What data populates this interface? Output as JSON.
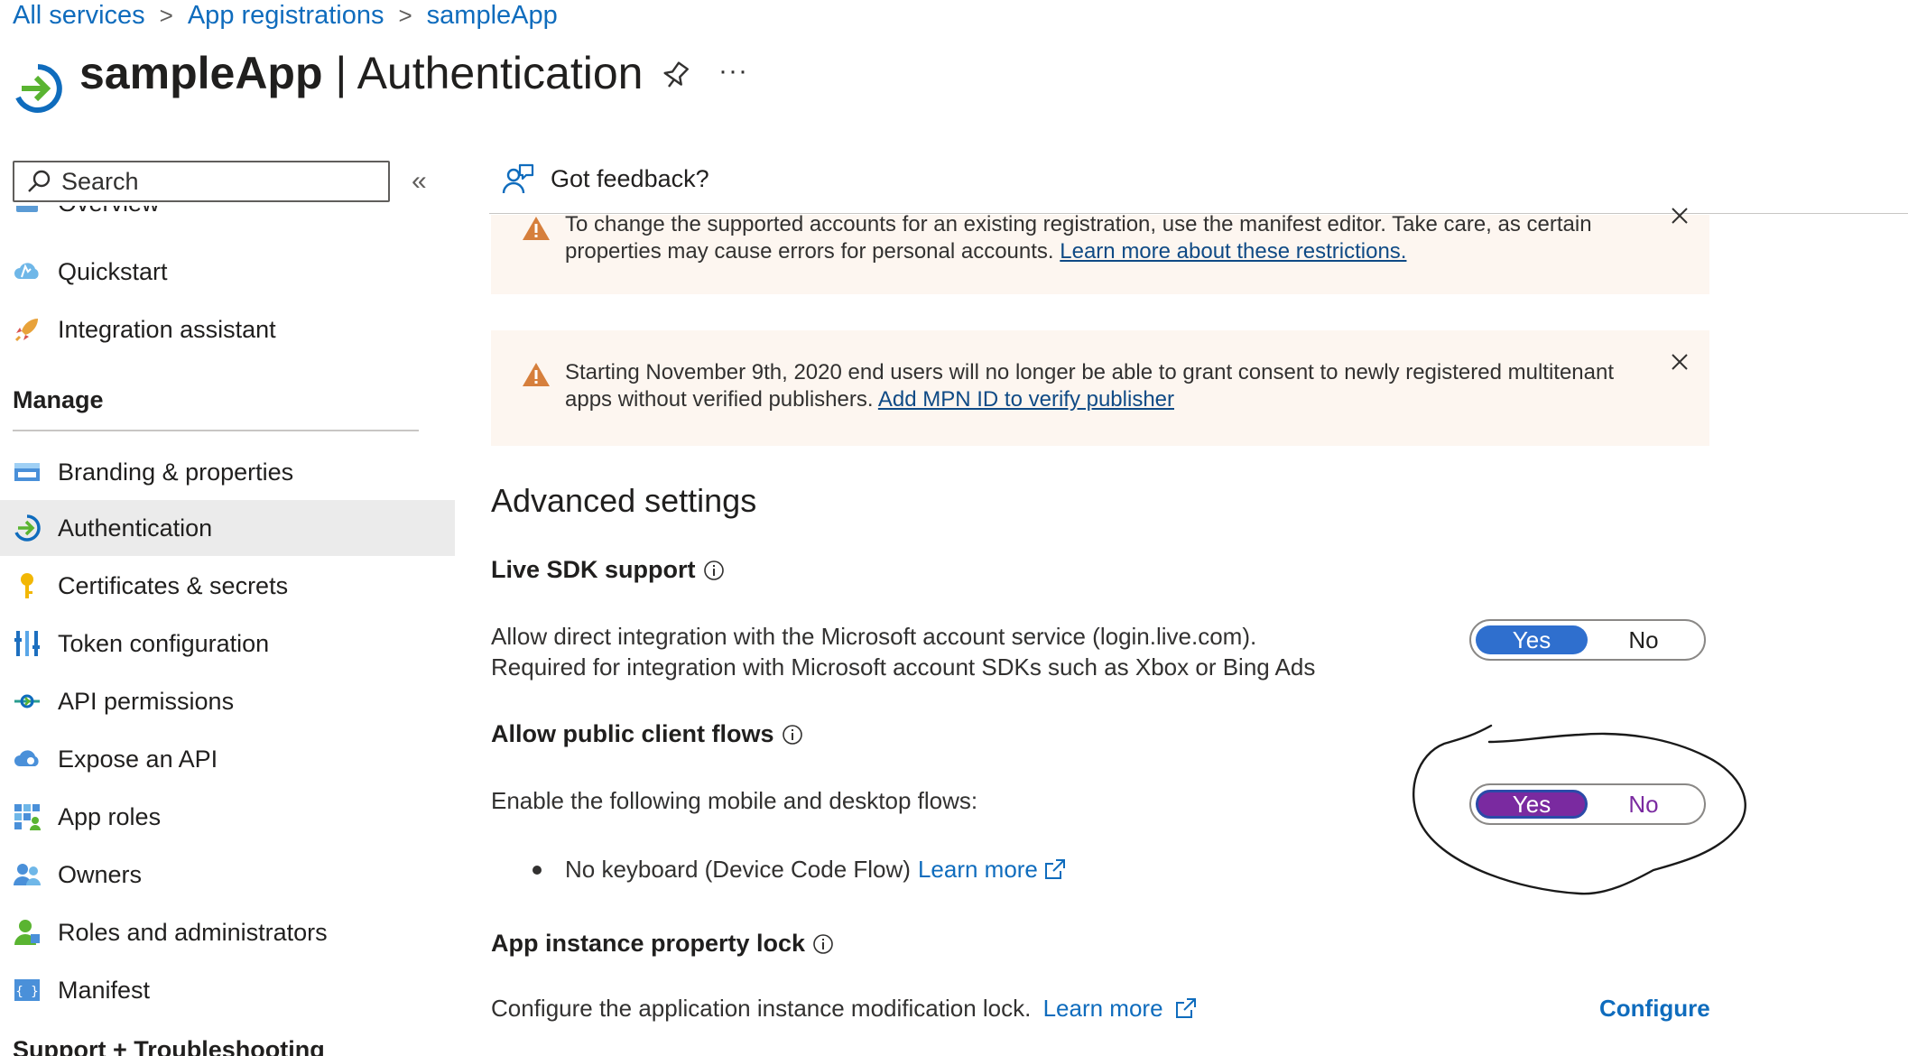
{
  "breadcrumb": [
    "All services",
    "App registrations",
    "sampleApp"
  ],
  "header": {
    "app_name": "sampleApp",
    "divider": "|",
    "page": "Authentication",
    "more": "···"
  },
  "sidebar": {
    "search_placeholder": "Search",
    "collapse_glyph": "«",
    "top_items": [
      {
        "label": "Overview",
        "icon": "overview-icon"
      },
      {
        "label": "Quickstart",
        "icon": "quickstart-cloud-icon"
      },
      {
        "label": "Integration assistant",
        "icon": "rocket-icon"
      }
    ],
    "manage_heading": "Manage",
    "manage_items": [
      {
        "label": "Branding & properties",
        "icon": "branding-icon"
      },
      {
        "label": "Authentication",
        "icon": "authentication-icon",
        "active": true
      },
      {
        "label": "Certificates & secrets",
        "icon": "key-icon"
      },
      {
        "label": "Token configuration",
        "icon": "token-bars-icon"
      },
      {
        "label": "API permissions",
        "icon": "api-permissions-icon"
      },
      {
        "label": "Expose an API",
        "icon": "cloud-api-icon"
      },
      {
        "label": "App roles",
        "icon": "app-roles-icon"
      },
      {
        "label": "Owners",
        "icon": "owners-icon"
      },
      {
        "label": "Roles and administrators",
        "icon": "roles-admin-icon"
      },
      {
        "label": "Manifest",
        "icon": "manifest-icon"
      }
    ],
    "support_heading": "Support + Troubleshooting"
  },
  "command_bar": {
    "feedback_label": "Got feedback?"
  },
  "banners": [
    {
      "text": "To change the supported accounts for an existing registration, use the manifest editor. Take care, as certain properties may cause errors for personal accounts.",
      "link": "Learn more about these restrictions."
    },
    {
      "text": "Starting November 9th, 2020 end users will no longer be able to grant consent to newly registered multitenant apps without verified publishers.",
      "link": "Add MPN ID to verify publisher"
    }
  ],
  "advanced": {
    "title": "Advanced settings",
    "live_sdk": {
      "title": "Live SDK support",
      "line1": "Allow direct integration with the Microsoft account service (login.live.com).",
      "line2": "Required for integration with Microsoft account SDKs such as Xbox or Bing Ads",
      "toggle": {
        "yes": "Yes",
        "no": "No",
        "selected": "Yes"
      }
    },
    "public_client": {
      "title": "Allow public client flows",
      "desc": "Enable the following mobile and desktop flows:",
      "bullet": "No keyboard (Device Code Flow)",
      "learn_more": "Learn more",
      "toggle": {
        "yes": "Yes",
        "no": "No",
        "selected": "Yes"
      }
    },
    "lock": {
      "title": "App instance property lock",
      "desc": "Configure the application instance modification lock.",
      "learn_more": "Learn more",
      "configure": "Configure"
    }
  },
  "colors": {
    "link": "#0f6cbd",
    "toggle_on": "#2f6fce",
    "toggle_purple": "#7a2aa0",
    "banner_bg": "#fdf6f0",
    "warning": "#d67f3c"
  }
}
